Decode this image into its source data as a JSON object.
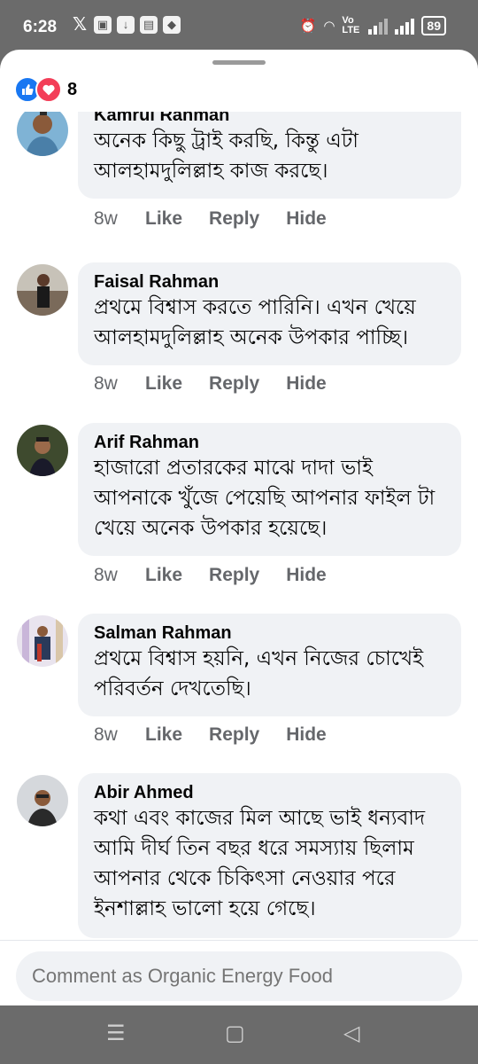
{
  "status_bar": {
    "time": "6:28",
    "battery": "89",
    "network": "Vo LTE"
  },
  "reactions": {
    "count": "8",
    "types": [
      "like-icon",
      "love-icon"
    ]
  },
  "comments": [
    {
      "author": "Kamrul Rahman",
      "text": "অনেক কিছু ট্রাই করছি, কিন্তু এটা আলহামদুলিল্লাহ কাজ করছে।",
      "time": "8w",
      "like": "Like",
      "reply": "Reply",
      "hide": "Hide",
      "avatar_color": "#4a7fa8"
    },
    {
      "author": "Faisal Rahman",
      "text": "প্রথমে বিশ্বাস করতে পারিনি। এখন খেয়ে আলহামদুলিল্লাহ অনেক উপকার পাচ্ছি।",
      "time": "8w",
      "like": "Like",
      "reply": "Reply",
      "hide": "Hide",
      "avatar_color": "#5a4a3a"
    },
    {
      "author": "Arif Rahman",
      "text": "হাজারো প্রতারকের মাঝে দাদা ভাই আপনাকে খুঁজে পেয়েছি আপনার ফাইল টা খেয়ে অনেক উপকার হয়েছে।",
      "time": "8w",
      "like": "Like",
      "reply": "Reply",
      "hide": "Hide",
      "avatar_color": "#3e4a2e"
    },
    {
      "author": "Salman Rahman",
      "text": "প্রথমে বিশ্বাস হয়নি, এখন নিজের চোখেই পরিবর্তন দেখতেছি।",
      "time": "8w",
      "like": "Like",
      "reply": "Reply",
      "hide": "Hide",
      "avatar_color": "#9a8aa8"
    },
    {
      "author": "Abir Ahmed",
      "text": "কথা এবং কাজের মিল আছে ভাই ধন্যবাদ আমি দীর্ঘ তিন বছর ধরে সমস্যায় ছিলাম আপনার থেকে চিকিৎসা নেওয়ার পরে ইনশাল্লাহ ভালো হয়ে গেছে।",
      "time": "",
      "like": "",
      "reply": "",
      "hide": "",
      "avatar_color": "#c9ccd0"
    }
  ],
  "comment_box": {
    "placeholder": "Comment as Organic Energy Food"
  },
  "colors": {
    "like_blue": "#1877f2",
    "love_red": "#f33e58",
    "bubble_bg": "#f0f2f5",
    "meta_gray": "#65676b"
  },
  "nav_bar": {
    "icons": [
      "menu-icon",
      "home-square-icon",
      "back-triangle-icon"
    ]
  }
}
